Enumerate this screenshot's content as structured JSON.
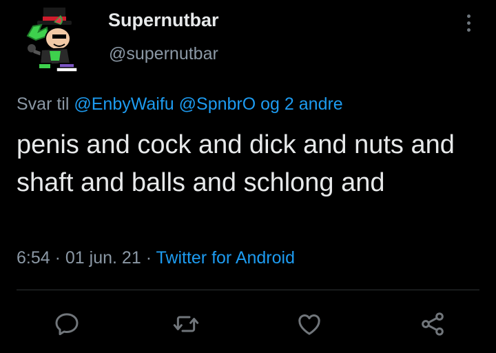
{
  "tweet": {
    "display_name": "Supernutbar",
    "handle": "@supernutbar",
    "reply_prefix": "Svar til",
    "reply_user_1": "@EnbyWaifu",
    "reply_user_2": "@SpnbrO",
    "reply_others": "og 2 andre",
    "text": "penis and cock and dick and nuts and shaft and balls and schlong and",
    "time": "6:54",
    "date": "01 jun. 21",
    "separator": "·",
    "source": "Twitter for Android"
  },
  "actions": {
    "reply_icon": "speech-bubble-icon",
    "retweet_icon": "retweet-icon",
    "like_icon": "heart-icon",
    "share_icon": "share-icon"
  },
  "colors": {
    "background": "#000000",
    "text": "#e7e9ea",
    "muted": "#8b98a5",
    "link": "#1d9bf0",
    "icon": "#71767b",
    "divider": "#2f3336"
  }
}
